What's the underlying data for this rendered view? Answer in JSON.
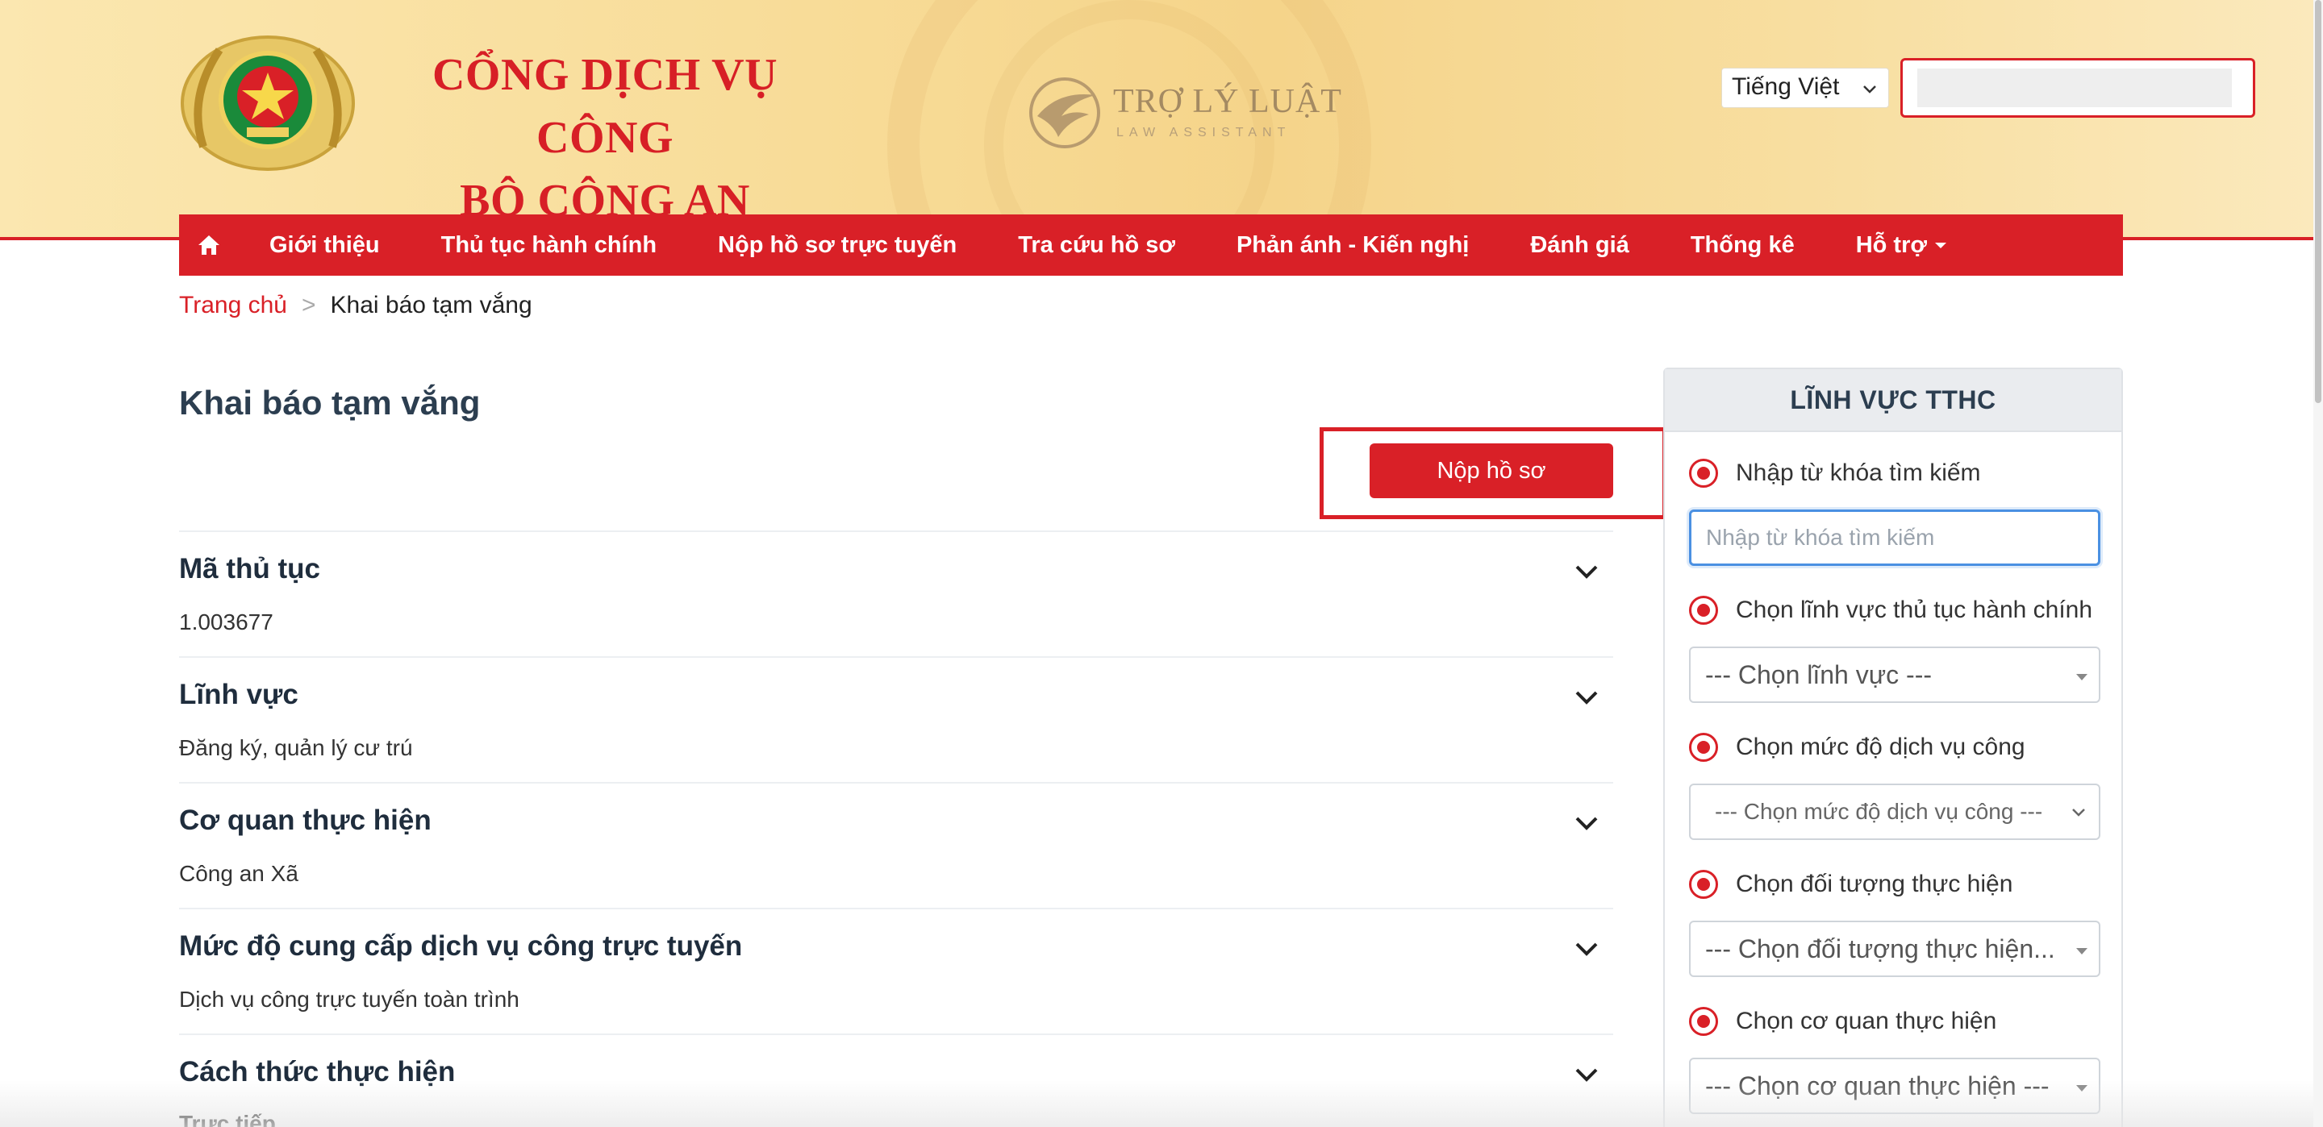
{
  "header": {
    "title_line1": "CỔNG DỊCH VỤ CÔNG",
    "title_line2": "BỘ CÔNG AN",
    "assistant_name": "TRỢ LÝ LUẬT",
    "assistant_sub": "LAW ASSISTANT",
    "language_selected": "Tiếng Việt",
    "search_value": ""
  },
  "nav": {
    "home_icon": "home-icon",
    "items": [
      {
        "label": "Giới thiệu"
      },
      {
        "label": "Thủ tục hành chính"
      },
      {
        "label": "Nộp hồ sơ trực tuyến"
      },
      {
        "label": "Tra cứu hồ sơ"
      },
      {
        "label": "Phản ánh - Kiến nghị"
      },
      {
        "label": "Đánh giá"
      },
      {
        "label": "Thống kê"
      },
      {
        "label": "Hỗ trợ"
      }
    ]
  },
  "breadcrumb": {
    "home": "Trang chủ",
    "separator": ">",
    "current": "Khai báo tạm vắng"
  },
  "main": {
    "page_title": "Khai báo tạm vắng",
    "submit_label": "Nộp hồ sơ",
    "rows": [
      {
        "label": "Mã thủ tục",
        "value": "1.003677"
      },
      {
        "label": "Lĩnh vực",
        "value": "Đăng ký, quản lý cư trú"
      },
      {
        "label": "Cơ quan thực hiện",
        "value": "Công an Xã"
      },
      {
        "label": "Mức độ cung cấp dịch vụ công trực tuyến",
        "value": "Dịch vụ công trực tuyến toàn trình"
      },
      {
        "label": "Cách thức thực hiện",
        "value": "Trực tiếp"
      }
    ]
  },
  "sidebar": {
    "title": "LĨNH VỰC TTHC",
    "keyword_label": "Nhập từ khóa tìm kiếm",
    "keyword_placeholder": "Nhập từ khóa tìm kiếm",
    "field_label": "Chọn lĩnh vực thủ tục hành chính",
    "field_value": "--- Chọn lĩnh vực ---",
    "level_label": "Chọn mức độ dịch vụ công",
    "level_value": "--- Chọn mức độ dịch vụ công ---",
    "subject_label": "Chọn đối tượng thực hiện",
    "subject_value": "--- Chọn đối tượng thực hiện...",
    "agency_label": "Chọn cơ quan thực hiện",
    "agency_value": "--- Chọn cơ quan thực hiện ---"
  },
  "colors": {
    "brand_red": "#d92027",
    "header_gold": "#f8dc98",
    "focus_blue": "#4a90e2"
  }
}
